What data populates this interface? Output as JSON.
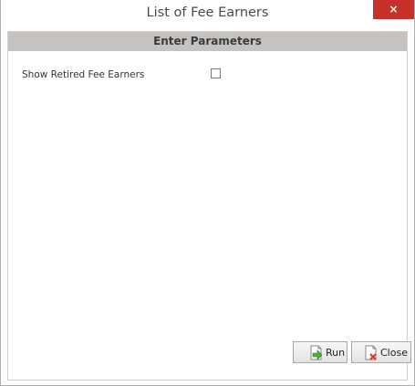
{
  "window": {
    "title": "List of Fee Earners",
    "close_label": "×"
  },
  "section": {
    "header": "Enter Parameters"
  },
  "params": {
    "show_retired_label": "Show Retired Fee Earners",
    "show_retired_checked": false
  },
  "buttons": {
    "run_label": "Run",
    "close_label": "Close"
  },
  "colors": {
    "close_button": "#c7302b",
    "header_bg": "#c5c2c0",
    "run_icon": "#4caf3a",
    "close_icon": "#d9322b"
  }
}
